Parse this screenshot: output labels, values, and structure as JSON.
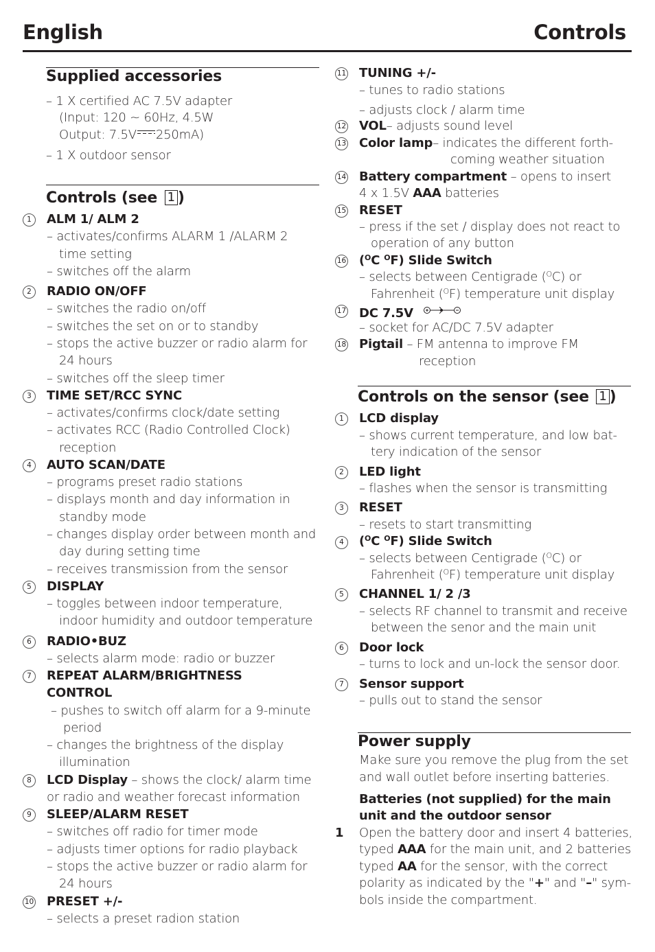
{
  "header": {
    "left_title": "English",
    "right_title": "Controls"
  },
  "supplied_accessories": {
    "heading": "Supplied accessories",
    "lines": [
      "– 1 X certified AC 7.5V adapter",
      "(Input: 120 ~ 60Hz, 4.5W",
      "Output: 7.5V",
      "250mA)",
      "– 1 X outdoor sensor"
    ]
  },
  "controls": {
    "heading": "Controls (see ",
    "figure_ref": "1",
    "heading_close": ")",
    "items": [
      {
        "num": "1",
        "title": "ALM 1/ ALM 2",
        "lines": [
          "– activates/confirms ALARM 1 /ALARM 2",
          "time setting",
          "– switches off the alarm"
        ]
      },
      {
        "num": "2",
        "title": "RADIO ON/OFF",
        "lines": [
          "– switches the radio on/off",
          "– switches the set on or to standby",
          "– stops the active buzzer or radio alarm for",
          "24 hours",
          "– switches off the sleep timer"
        ]
      },
      {
        "num": "3",
        "title": "TIME SET/RCC SYNC",
        "lines": [
          "– activates/confirms clock/date setting",
          "– activates RCC (Radio Controlled Clock)",
          "reception"
        ]
      },
      {
        "num": "4",
        "title": "AUTO SCAN/DATE",
        "lines": [
          "– programs preset radio stations",
          "– displays month and day information in",
          "standby mode",
          "– changes display order between month and",
          "day during setting time",
          "– receives transmission from the sensor"
        ]
      },
      {
        "num": "5",
        "title": "DISPLAY",
        "lines": [
          "– toggles between indoor temperature,",
          "indoor humidity and outdoor temperature"
        ]
      },
      {
        "num": "6",
        "title": "RADIO•BUZ",
        "lines": [
          "– selects alarm mode: radio or buzzer"
        ]
      },
      {
        "num": "7",
        "title": "REPEAT ALARM/BRIGHTNESS",
        "title2": "CONTROL",
        "lines": [
          "– pushes to switch off alarm for a 9-minute",
          "period",
          "– changes the brightness of the display",
          "illumination"
        ]
      },
      {
        "num": "8",
        "title": "LCD Display",
        "inline": " – shows the clock/ alarm time",
        "lines": [
          "or radio and weather forecast information"
        ]
      },
      {
        "num": "9",
        "title": "SLEEP/ALARM RESET",
        "lines": [
          "– switches off radio for timer mode",
          "– adjusts timer options for radio playback",
          "– stops the active buzzer or radio alarm for",
          "24 hours"
        ]
      },
      {
        "num": "10",
        "title": "PRESET +/-",
        "lines": [
          "– selects a preset radion station"
        ]
      },
      {
        "num": "11",
        "title": "TUNING +/-",
        "lines": [
          "– tunes to radio stations",
          "– adjusts clock / alarm time"
        ]
      },
      {
        "num": "12",
        "title": "VOL",
        "inline": "– adjusts sound level"
      },
      {
        "num": "13",
        "title": "Color lamp",
        "inline": "– indicates the different forth-",
        "lines": [
          "coming weather situation"
        ]
      },
      {
        "num": "14",
        "title": "Battery compartment",
        "inline": " – opens to insert",
        "lines_pre": "4 x 1.5V ",
        "lines_bold": "AAA",
        "lines_post": " batteries"
      },
      {
        "num": "15",
        "title": "RESET",
        "lines": [
          "– press if the set / display does not react to",
          "operation of any button"
        ]
      },
      {
        "num": "16",
        "title_a": "(",
        "title_b": "C ",
        "title_c": "F) Slide Switch",
        "sup": "O",
        "lines_a": [
          "– selects between Centigrade (",
          "C) or"
        ],
        "lines_b": [
          "Fahrenheit (",
          "F) temperature unit display"
        ]
      },
      {
        "num": "17",
        "title": "DC 7.5V",
        "lines": [
          "– socket for AC/DC 7.5V adapter"
        ]
      },
      {
        "num": "18",
        "title": "Pigtail",
        "inline": " – FM antenna to improve FM",
        "lines": [
          "reception"
        ]
      }
    ]
  },
  "sensor_controls": {
    "heading": "Controls on the sensor (see ",
    "figure_ref": "1",
    "heading_close": ")",
    "items": [
      {
        "num": "1",
        "title": "LCD display",
        "lines": [
          "– shows  current temperature, and low bat-",
          "tery indication of the sensor"
        ]
      },
      {
        "num": "2",
        "title": "LED light",
        "lines": [
          "– flashes when the sensor is transmitting"
        ]
      },
      {
        "num": "3",
        "title": "RESET",
        "lines": [
          "– resets to start transmitting"
        ]
      },
      {
        "num": "4",
        "title_a": "(",
        "title_b": "C ",
        "title_c": "F) Slide Switch",
        "sup": "O",
        "lines_a": [
          "– selects between Centigrade (",
          "C) or"
        ],
        "lines_b": [
          "Fahrenheit (",
          "F) temperature unit display"
        ]
      },
      {
        "num": "5",
        "title": "CHANNEL 1/ 2 /3",
        "lines": [
          "– selects RF channel to transmit and receive",
          "between the senor and the main unit"
        ]
      },
      {
        "num": "6",
        "title": "Door lock",
        "lines": [
          "– turns to lock and un-lock the sensor door."
        ]
      },
      {
        "num": "7",
        "title": "Sensor support",
        "lines": [
          "– pulls out to stand the sensor"
        ]
      }
    ]
  },
  "power_supply": {
    "heading": "Power supply",
    "intro": [
      "Make sure you remove the plug from the set",
      "and wall outlet before inserting batteries."
    ],
    "subheading": [
      "Batteries (not supplied) for the main",
      "unit and the outdoor sensor"
    ],
    "step": {
      "num": "1",
      "l1": "Open the battery door and insert 4 batteries,",
      "l2a": "typed ",
      "l2b": "AAA",
      "l2c": " for the main unit, and 2 batteries",
      "l3a": "typed ",
      "l3b": "AA",
      "l3c": " for the sensor, with the correct",
      "l4a": "polarity as indicated by the \"",
      "l4b": "+",
      "l4c": "\" and \"",
      "l4d": "–",
      "l4e": "\" sym-",
      "l5": "bols inside the compartment."
    }
  }
}
